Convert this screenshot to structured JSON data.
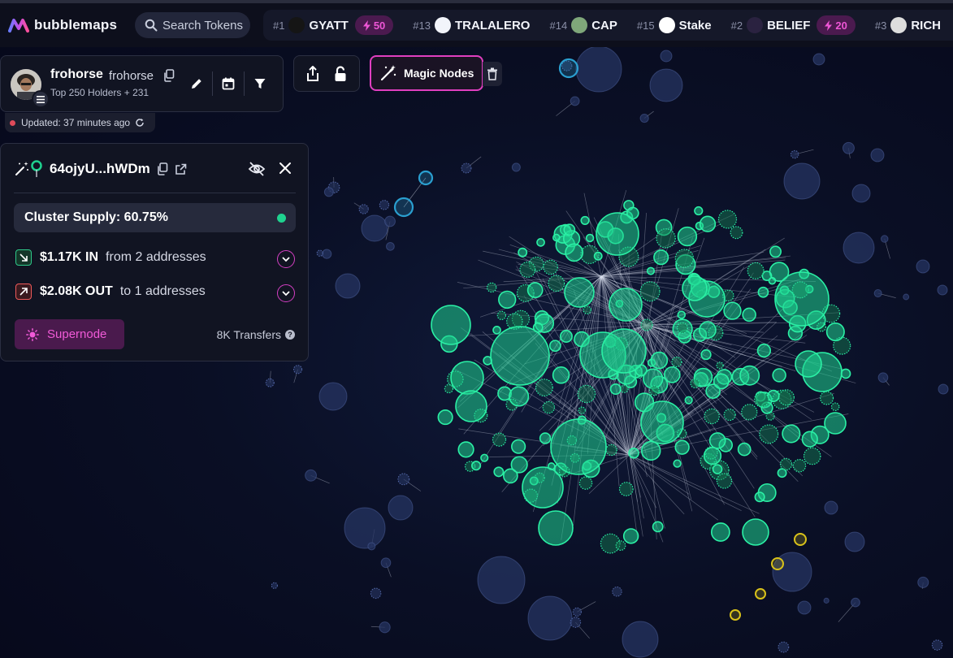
{
  "brand": {
    "name": "bubblemaps"
  },
  "search": {
    "placeholder": "Search Tokens"
  },
  "ticker": [
    {
      "rank": "#1",
      "name": "GYATT",
      "boost": "50",
      "icon": "gyatt-token-icon",
      "color": "#151515"
    },
    {
      "rank": "#13",
      "name": "TRALALERO",
      "boost": "",
      "icon": "tralalero-token-icon",
      "color": "#f2f4fa"
    },
    {
      "rank": "#14",
      "name": "CAP",
      "boost": "",
      "icon": "cap-token-icon",
      "color": "#7fa77a"
    },
    {
      "rank": "#15",
      "name": "Stake",
      "boost": "",
      "icon": "stake-token-icon",
      "color": "#ffffff"
    },
    {
      "rank": "#2",
      "name": "BELIEF",
      "boost": "20",
      "icon": "belief-token-icon",
      "color": "#2a2240"
    },
    {
      "rank": "#3",
      "name": "RICH",
      "boost": "",
      "icon": "rich-token-icon",
      "color": "#dddddd"
    }
  ],
  "profile": {
    "name": "frohorse",
    "handle": "frohorse",
    "subtitle": "Top 250 Holders + 231",
    "updated": "Updated: 37 minutes ago"
  },
  "magic": {
    "label": "Magic Nodes"
  },
  "cluster": {
    "address": "64ojyU...hWDm",
    "supply": "Cluster Supply: 60.75%",
    "in_amount": "$1.17K IN",
    "in_desc": "from 2 addresses",
    "out_amount": "$2.08K OUT",
    "out_desc": "to 1 addresses",
    "supernode": "Supernode",
    "transfers": "8K Transfers",
    "qmark": "?"
  },
  "colors": {
    "accent_pink": "#e03fc0",
    "cluster_green": "#1fd28f",
    "in_green": "#2fc98a",
    "out_red": "#ef5a5a",
    "highlight_blue": "#2a9fd0",
    "highlight_yellow": "#d9c21a",
    "bubble_dark": "#1a2545"
  }
}
